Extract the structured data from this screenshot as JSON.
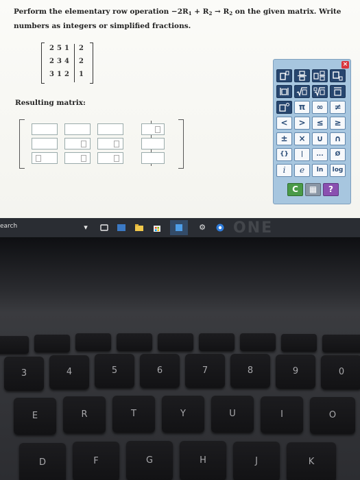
{
  "question": {
    "text_before": "Perform the elementary row operation ",
    "operation_prefix": "−2R",
    "sub1": "1",
    "plus": " + R",
    "sub2": "2",
    "arrow": " → R",
    "sub3": "2",
    "text_after": " on the given matrix. Write numbers as integers or simplified fractions."
  },
  "given_matrix": {
    "rows": [
      [
        "2",
        "5",
        "1",
        "2"
      ],
      [
        "2",
        "3",
        "4",
        "2"
      ],
      [
        "3",
        "1",
        "2",
        "1"
      ]
    ]
  },
  "resulting_label": "Resulting matrix:",
  "palette": {
    "close": "×",
    "row3": [
      "π",
      "∞",
      "≠"
    ],
    "row4": [
      "<",
      ">",
      "≤",
      "≥"
    ],
    "row5": [
      "±",
      "×",
      "∪",
      "∩"
    ],
    "row6": [
      "{}",
      "|",
      "...",
      "Ø"
    ],
    "row7": [
      "i",
      "e",
      "ln",
      "log"
    ],
    "row8": [
      "C",
      "▦",
      "?"
    ]
  },
  "taskbar": {
    "search_text": "earch"
  },
  "keyboard": {
    "number_row": [
      "3",
      "4",
      "5",
      "6",
      "7",
      "8",
      "9",
      "0"
    ],
    "top_row": [
      "E",
      "R",
      "T",
      "Y",
      "U",
      "I",
      "O"
    ],
    "home_row": [
      "D",
      "F",
      "G",
      "H",
      "J",
      "K"
    ]
  }
}
